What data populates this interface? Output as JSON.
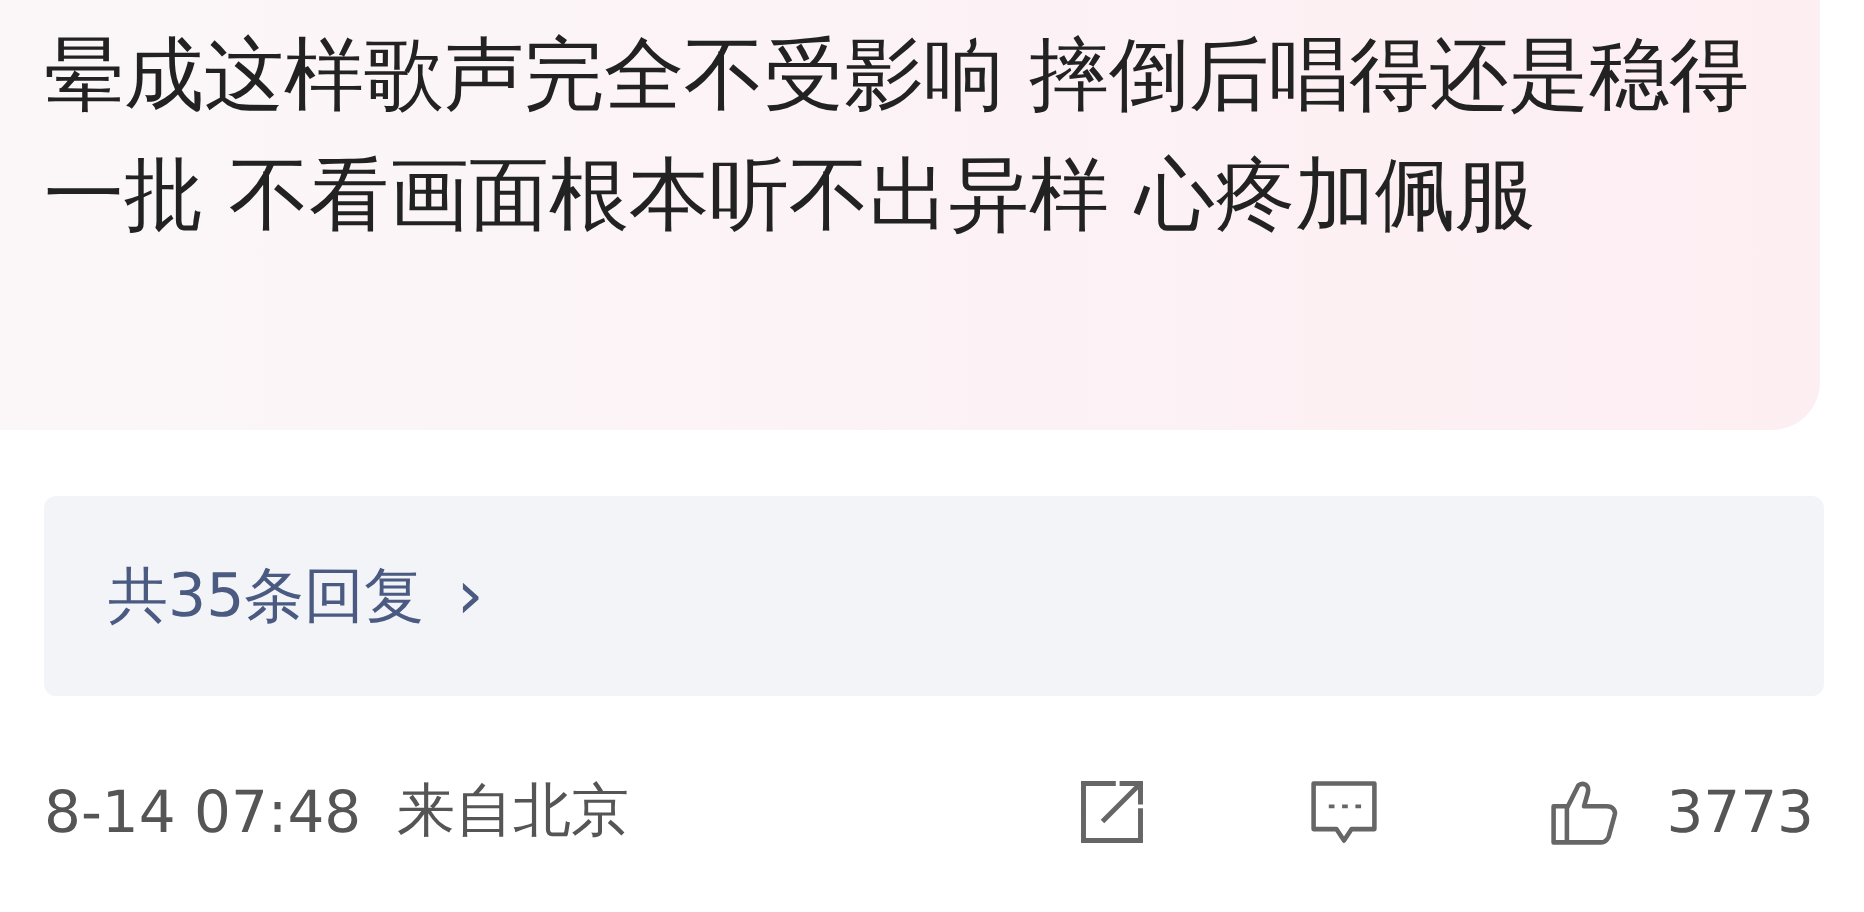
{
  "comment": {
    "text": "晕成这样歌声完全不受影响 摔倒后唱得还是稳得一批 不看画面根本听不出异样 心疼加佩服"
  },
  "replies": {
    "label": "共35条回复",
    "arrow": "›"
  },
  "footer": {
    "time": "8-14 07:48",
    "location": "来自北京",
    "likes": "3773"
  }
}
